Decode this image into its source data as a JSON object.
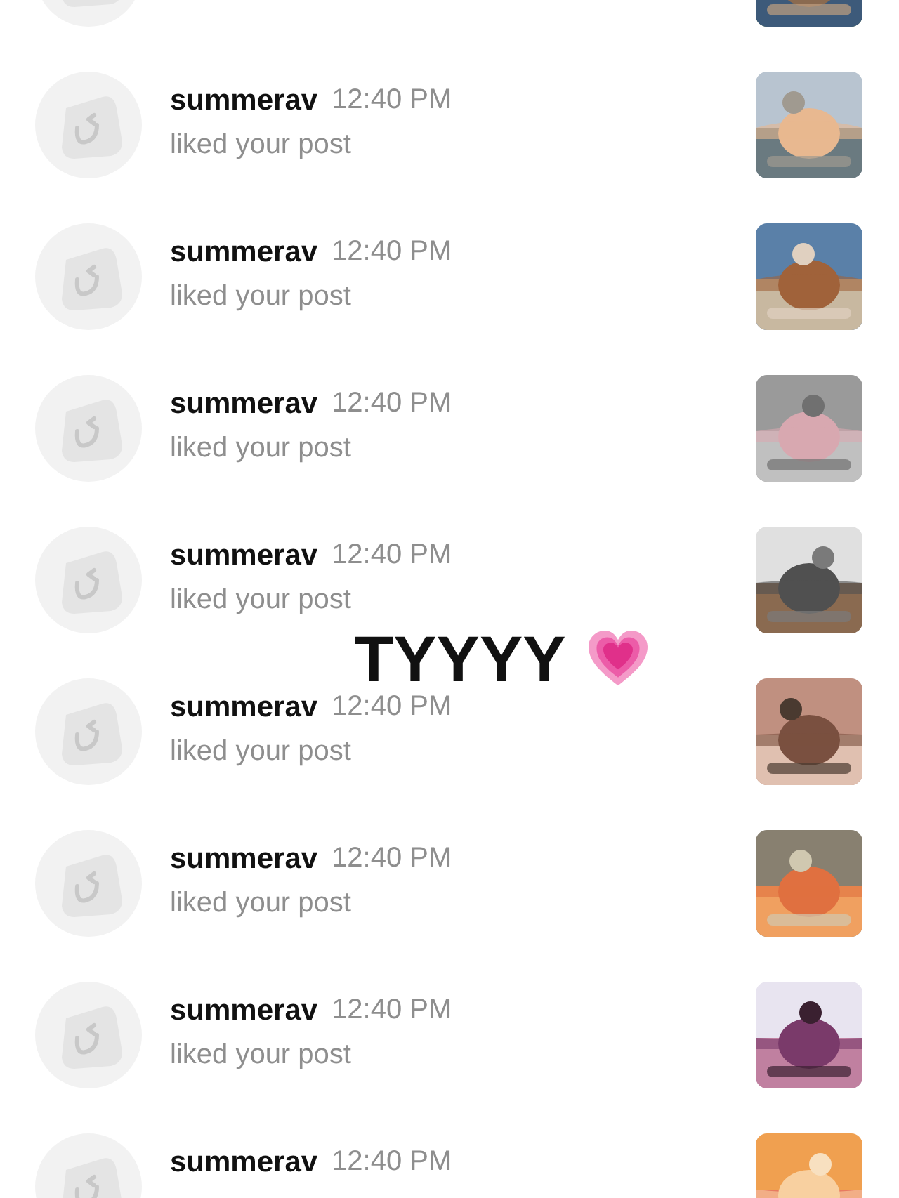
{
  "notifications": [
    {
      "thumbnail": {
        "kind": "picture"
      }
    },
    {
      "username": "summerav",
      "time": "12:40 PM",
      "action": "liked your post",
      "thumbnail": {
        "kind": "picture"
      }
    },
    {
      "username": "summerav",
      "time": "12:40 PM",
      "action": "liked your post",
      "thumbnail": {
        "kind": "picture"
      }
    },
    {
      "username": "summerav",
      "time": "12:40 PM",
      "action": "liked your post",
      "thumbnail": {
        "kind": "picture"
      }
    },
    {
      "username": "summerav",
      "time": "12:40 PM",
      "action": "liked your post",
      "thumbnail": {
        "kind": "picture"
      }
    },
    {
      "username": "summerav",
      "time": "12:40 PM",
      "action": "liked your post",
      "thumbnail": {
        "kind": "picture"
      }
    },
    {
      "username": "summerav",
      "time": "12:40 PM",
      "action": "liked your post",
      "thumbnail": {
        "kind": "picture"
      }
    },
    {
      "username": "summerav",
      "time": "12:40 PM",
      "action": "liked your post",
      "thumbnail": {
        "kind": "picture"
      }
    },
    {
      "username": "summerav",
      "time": "12:40 PM",
      "thumbnail": {
        "kind": "picture"
      }
    }
  ],
  "caption": {
    "text": "TYYYY"
  }
}
